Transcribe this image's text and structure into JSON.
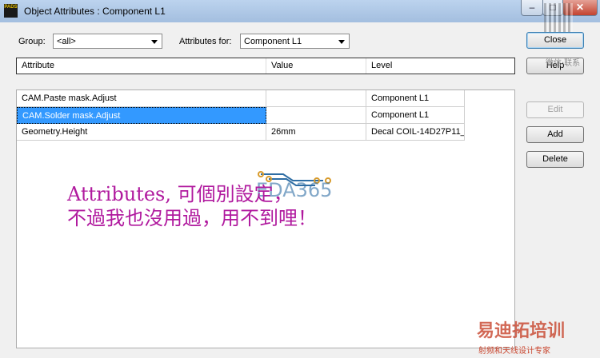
{
  "window": {
    "title": "Object Attributes : Component L1",
    "icon_text": "PADS",
    "controls": {
      "minimize": "–",
      "maximize": "□",
      "close": "✕"
    }
  },
  "filters": {
    "group_label": "Group:",
    "group_value": "<all>",
    "attributes_for_label": "Attributes for:",
    "attributes_for_value": "Component L1"
  },
  "table": {
    "columns": [
      "Attribute",
      "Value",
      "Level"
    ],
    "rows": [
      {
        "attribute": "CAM.Paste mask.Adjust",
        "value": "",
        "level": "Component L1"
      },
      {
        "attribute": "CAM.Solder mask.Adjust",
        "value": "",
        "level": "Component L1",
        "selected": true
      },
      {
        "attribute": "Geometry.Height",
        "value": "26mm",
        "level": "Decal COIL-14D27P11_"
      }
    ]
  },
  "buttons": {
    "close": "Close",
    "help": "Help",
    "edit": "Edit",
    "add": "Add",
    "delete": "Delete"
  },
  "annotation": {
    "line1": "Attributes, 可個別設定，",
    "line2": "不過我也沒用過，用不到哩！",
    "color": "#b0199e"
  },
  "watermark": {
    "logo_text": "EDA365",
    "brand_text": "易迪拓培训",
    "brand_sub": "射频和天线设计专家",
    "wechat_text": "微信·联系",
    "logo_color": "#2e6da4",
    "brand_color": "#c8442c"
  }
}
